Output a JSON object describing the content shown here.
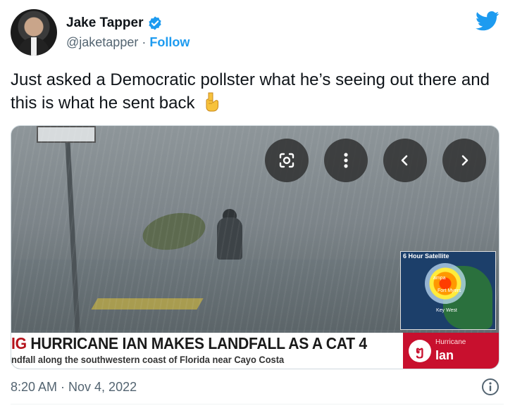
{
  "author": {
    "name": "Jake Tapper",
    "handle": "@jaketapper",
    "separator": "·",
    "follow_label": "Follow"
  },
  "tweet": {
    "text": "Just asked a Democratic pollster what he’s seeing out there and this is what he sent back",
    "timestamp": "8:20 AM · Nov 4, 2022"
  },
  "media": {
    "sign_text": "",
    "satellite_title": "6 Hour Satellite",
    "satellite_labels": [
      "ampa",
      "Fort Myers",
      "Key West"
    ],
    "headline_prefix": "IG",
    "headline": "HURRICANE IAN MAKES LANDFALL AS A CAT 4",
    "subheadline": "ndfall along the southwestern coast of Florida near Cayo Costa",
    "badge_top": "Hurricane",
    "badge_name": "Ian",
    "badge_icon": "ໆ"
  },
  "icons": {
    "verified": "verified-badge-icon",
    "bird": "twitter-bird-icon",
    "point": "pointing-down-emoji-icon",
    "lens": "lens-icon",
    "more": "more-icon",
    "prev": "chevron-left-icon",
    "next": "chevron-right-icon",
    "info": "info-icon"
  },
  "colors": {
    "accent": "#1d9bf0",
    "breaking_red": "#c8102e"
  }
}
